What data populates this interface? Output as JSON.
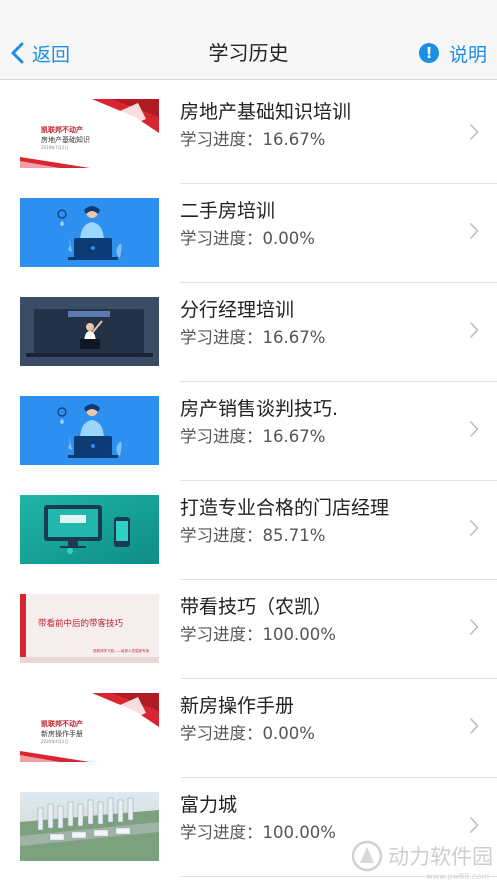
{
  "header": {
    "back_label": "返回",
    "title": "学习历史",
    "help_label": "说明",
    "accent_color": "#1b8ee6"
  },
  "courses": [
    {
      "title": "房地产基础知识培训",
      "progress": "学习进度：16.67%",
      "thumb": {
        "style": "red-triangle",
        "line1": "凯联邦不动产",
        "line2": "房地产基础知识",
        "line3": "2019年7月2日"
      }
    },
    {
      "title": "二手房培训",
      "progress": "学习进度：0.00%",
      "thumb": {
        "style": "blue-person"
      }
    },
    {
      "title": "分行经理培训",
      "progress": "学习进度：16.67%",
      "thumb": {
        "style": "dark-screen"
      }
    },
    {
      "title": "房产销售谈判技巧.",
      "progress": "学习进度：16.67%",
      "thumb": {
        "style": "blue-person"
      }
    },
    {
      "title": "打造专业合格的门店经理",
      "progress": "学习进度：85.71%",
      "thumb": {
        "style": "teal-devices"
      }
    },
    {
      "title": "带看技巧（农凯）",
      "progress": "学习进度：100.00%",
      "thumb": {
        "style": "pink-banner",
        "caption": "带看前中后的带客技巧",
        "foot": "凯联邦学习班——培训人员讲座专用"
      }
    },
    {
      "title": "新房操作手册",
      "progress": "学习进度：0.00%",
      "thumb": {
        "style": "red-triangle",
        "line1": "凯联邦不动产",
        "line2": "新房操作手册",
        "line3": "2020年4月2日"
      }
    },
    {
      "title": "富力城",
      "progress": "学习进度：100.00%",
      "thumb": {
        "style": "city-aerial"
      }
    }
  ],
  "watermark": {
    "text": "动力软件园",
    "sub": "www.pw88.com"
  }
}
